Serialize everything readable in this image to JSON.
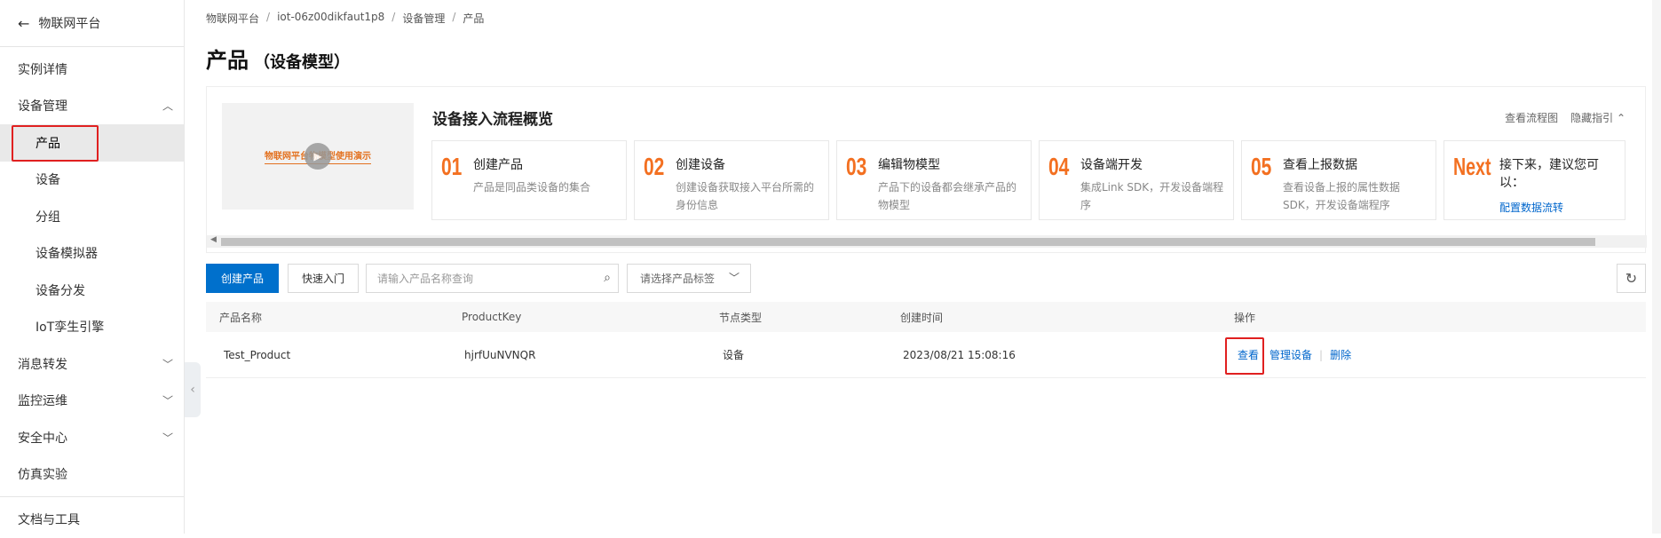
{
  "sidebar": {
    "back_label": "物联网平台",
    "items": [
      {
        "label": "实例详情"
      },
      {
        "label": "设备管理"
      },
      {
        "label": "产品"
      },
      {
        "label": "设备"
      },
      {
        "label": "分组"
      },
      {
        "label": "设备模拟器"
      },
      {
        "label": "设备分发"
      },
      {
        "label": "IoT孪生引擎"
      },
      {
        "label": "消息转发"
      },
      {
        "label": "监控运维"
      },
      {
        "label": "安全中心"
      },
      {
        "label": "仿真实验"
      },
      {
        "label": "文档与工具"
      }
    ]
  },
  "breadcrumb": [
    "物联网平台",
    "iot-06z00dikfaut1p8",
    "设备管理",
    "产品"
  ],
  "page": {
    "title": "产品",
    "subtitle": "（设备模型）"
  },
  "guide": {
    "video_text": "物联网平台物模型使用演示",
    "title": "设备接入流程概览",
    "link_flow": "查看流程图",
    "link_hide": "隐藏指引 ⌃",
    "steps": [
      {
        "num": "01",
        "title": "创建产品",
        "desc": "产品是同品类设备的集合"
      },
      {
        "num": "02",
        "title": "创建设备",
        "desc": "创建设备获取接入平台所需的身份信息"
      },
      {
        "num": "03",
        "title": "编辑物模型",
        "desc": "产品下的设备都会继承产品的物模型"
      },
      {
        "num": "04",
        "title": "设备端开发",
        "desc": "集成Link SDK，开发设备端程序"
      },
      {
        "num": "05",
        "title": "查看上报数据",
        "desc": "查看设备上报的属性数据SDK，开发设备端程序"
      },
      {
        "num": "Next",
        "title": "接下来，建议您可以：",
        "link": "配置数据流转"
      }
    ]
  },
  "toolbar": {
    "create_label": "创建产品",
    "quick_label": "快速入门",
    "search_placeholder": "请输入产品名称查询",
    "tag_placeholder": "请选择产品标签"
  },
  "table": {
    "headers": [
      "产品名称",
      "ProductKey",
      "节点类型",
      "创建时间",
      "操作"
    ],
    "rows": [
      {
        "name": "Test_Product",
        "key": "hjrfUuNVNQR",
        "node": "设备",
        "created": "2023/08/21 15:08:16"
      }
    ],
    "actions": {
      "view": "查看",
      "manage": "管理设备",
      "delete": "删除"
    }
  },
  "colors": {
    "accent": "#0070cc",
    "step_number": "#f37021",
    "highlight": "#e02020"
  }
}
